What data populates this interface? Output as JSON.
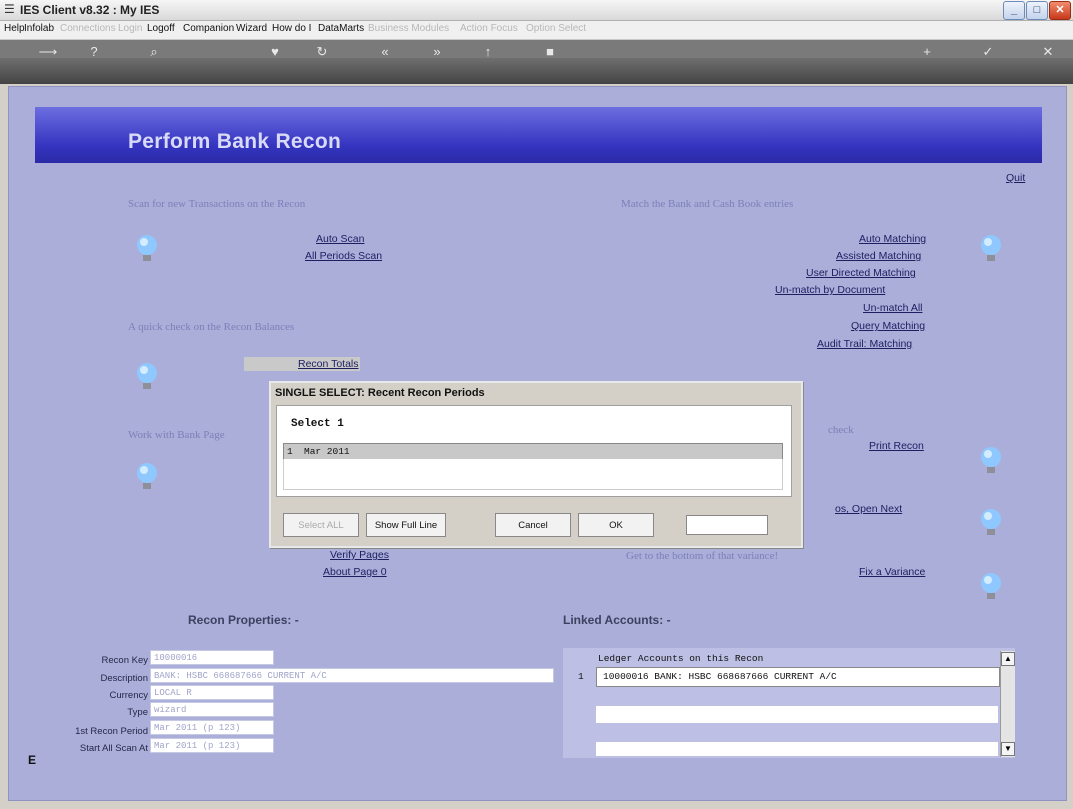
{
  "window": {
    "title": "IES Client v8.32 : My IES",
    "minimize": "_",
    "maximize": "□",
    "close": "✕"
  },
  "menu": {
    "items": [
      {
        "label": "Help",
        "dim": false
      },
      {
        "label": "Infolab",
        "dim": false
      },
      {
        "label": "Connections",
        "dim": true
      },
      {
        "label": "Login",
        "dim": true
      },
      {
        "label": "Logoff",
        "dim": false
      },
      {
        "label": "Companion",
        "dim": false
      },
      {
        "label": "Wizard",
        "dim": false
      },
      {
        "label": "How do I",
        "dim": false
      },
      {
        "label": "DataMarts",
        "dim": false
      },
      {
        "label": "Business Modules",
        "dim": true
      },
      {
        "label": "Action Focus",
        "dim": true
      },
      {
        "label": "Option Select",
        "dim": true
      }
    ]
  },
  "page": {
    "title": "Perform Bank Recon",
    "quit": "Quit"
  },
  "sections": {
    "scan": {
      "heading": "Scan for new Transactions on the Recon",
      "links": [
        "Auto Scan",
        "All Periods Scan"
      ]
    },
    "check": {
      "heading": "A quick check on the Recon Balances",
      "links": [
        "Recon Totals"
      ]
    },
    "pages": {
      "heading": "Work with Bank Page",
      "links": [
        "Verify Pages",
        "About Page 0"
      ]
    },
    "match": {
      "heading": "Match the Bank and Cash Book entries",
      "links": [
        "Auto Matching",
        "Assisted Matching",
        "User Directed Matching",
        "Un-match by Document",
        "Un-match All",
        "Query Matching",
        "Audit Trail: Matching"
      ]
    },
    "print": {
      "heading": "check",
      "links": [
        "Print Recon"
      ]
    },
    "close": {
      "links": [
        "os, Open Next"
      ]
    },
    "variance": {
      "heading": "Get to the bottom of that variance!",
      "links": [
        "Fix a Variance"
      ]
    }
  },
  "properties": {
    "heading": "Recon Properties: -",
    "fields": [
      {
        "label": "Recon Key",
        "value": "10000016"
      },
      {
        "label": "Description",
        "value": "BANK: HSBC 668687666 CURRENT A/C"
      },
      {
        "label": "Currency",
        "value": "LOCAL R"
      },
      {
        "label": "Type",
        "value": "wizard"
      },
      {
        "label": "1st Recon Period",
        "value": "Mar 2011 (p 123)"
      },
      {
        "label": "Start All Scan At",
        "value": "Mar 2011 (p 123)"
      }
    ]
  },
  "linked": {
    "heading": "Linked Accounts: -",
    "column": "Ledger Accounts on this Recon",
    "rows": [
      {
        "num": "1",
        "text": "10000016 BANK: HSBC 668687666 CURRENT A/C"
      }
    ]
  },
  "dialog": {
    "title": "SINGLE SELECT: Recent Recon Periods",
    "prompt": "Select 1",
    "rows": [
      {
        "num": "1",
        "text": "Mar 2011"
      }
    ],
    "buttons": {
      "select_all": "Select ALL",
      "show_full": "Show Full Line",
      "cancel": "Cancel",
      "ok": "OK"
    },
    "input": ""
  },
  "colors": {
    "banner": "#3434c0",
    "background": "#aaaed9",
    "toolbar": "#555555"
  }
}
